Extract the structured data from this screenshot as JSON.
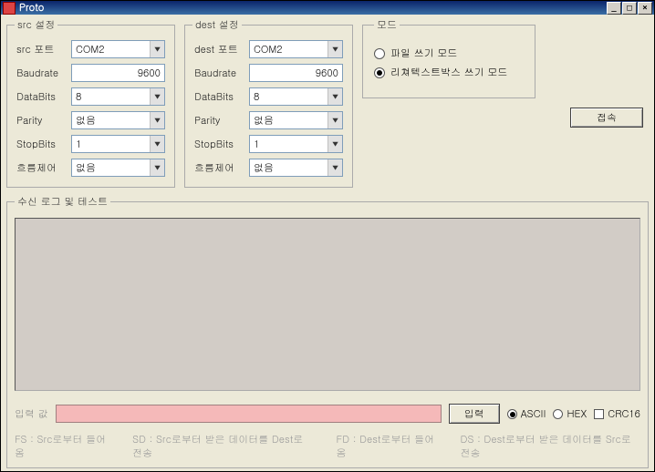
{
  "window": {
    "title": "Proto"
  },
  "src": {
    "legend": "src 설정",
    "port_label": "src 포트",
    "port_value": "COM2",
    "baud_label": "Baudrate",
    "baud_value": "9600",
    "databits_label": "DataBits",
    "databits_value": "8",
    "parity_label": "Parity",
    "parity_value": "없음",
    "stopbits_label": "StopBits",
    "stopbits_value": "1",
    "flow_label": "흐름제어",
    "flow_value": "없음"
  },
  "dest": {
    "legend": "dest 설정",
    "port_label": "dest 포트",
    "port_value": "COM2",
    "baud_label": "Baudrate",
    "baud_value": "9600",
    "databits_label": "DataBits",
    "databits_value": "8",
    "parity_label": "Parity",
    "parity_value": "없음",
    "stopbits_label": "StopBits",
    "stopbits_value": "1",
    "flow_label": "흐름제어",
    "flow_value": "없음"
  },
  "mode": {
    "legend": "모드",
    "file_label": "파일 쓰기 모드",
    "rtb_label": "리쳐텍스트박스 쓰기 모드",
    "selected": "rtb"
  },
  "buttons": {
    "connect": "접속",
    "send": "입력"
  },
  "log": {
    "legend": "수신 로그 및 테스트",
    "input_label": "입력 값",
    "input_value": "",
    "format_ascii": "ASCII",
    "format_hex": "HEX",
    "format_selected": "ascii",
    "crc_label": "CRC16",
    "crc_checked": false
  },
  "footer": {
    "fs": "FS : Src로부터 들어옴",
    "sd": "SD : Src로부터 받은 데이터를 Dest로 전송",
    "fd": "FD : Dest로부터 들어옴",
    "ds": "DS : Dest로부터 받은 데이터를 Src로 전송"
  }
}
